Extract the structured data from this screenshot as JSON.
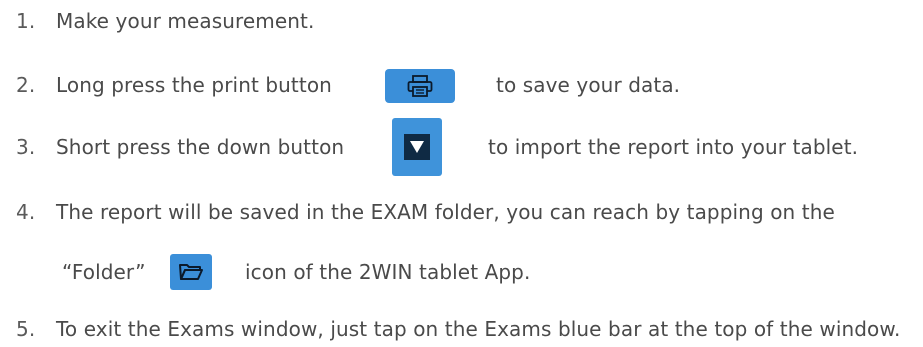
{
  "steps": [
    {
      "num": "1.",
      "text": "Make your measurement."
    },
    {
      "num": "2.",
      "before": "Long press the print button",
      "after": "to save your data.",
      "icon": "print-icon"
    },
    {
      "num": "3.",
      "before": "Short press the down button",
      "after": "to import the report into your tablet.",
      "icon": "down-arrow-icon"
    },
    {
      "num": "4.",
      "line1": "The report will be saved in the EXAM folder, you can reach by tapping on the",
      "before": "“Folder”",
      "after": "icon of the 2WIN tablet App.",
      "icon": "folder-icon"
    },
    {
      "num": "5.",
      "text": "To exit the Exams window, just tap on the Exams blue bar at the top of the window."
    }
  ],
  "colors": {
    "text": "#4a4a4a",
    "button_blue": "#3b8fd9",
    "down_square": "#0f2a44"
  }
}
